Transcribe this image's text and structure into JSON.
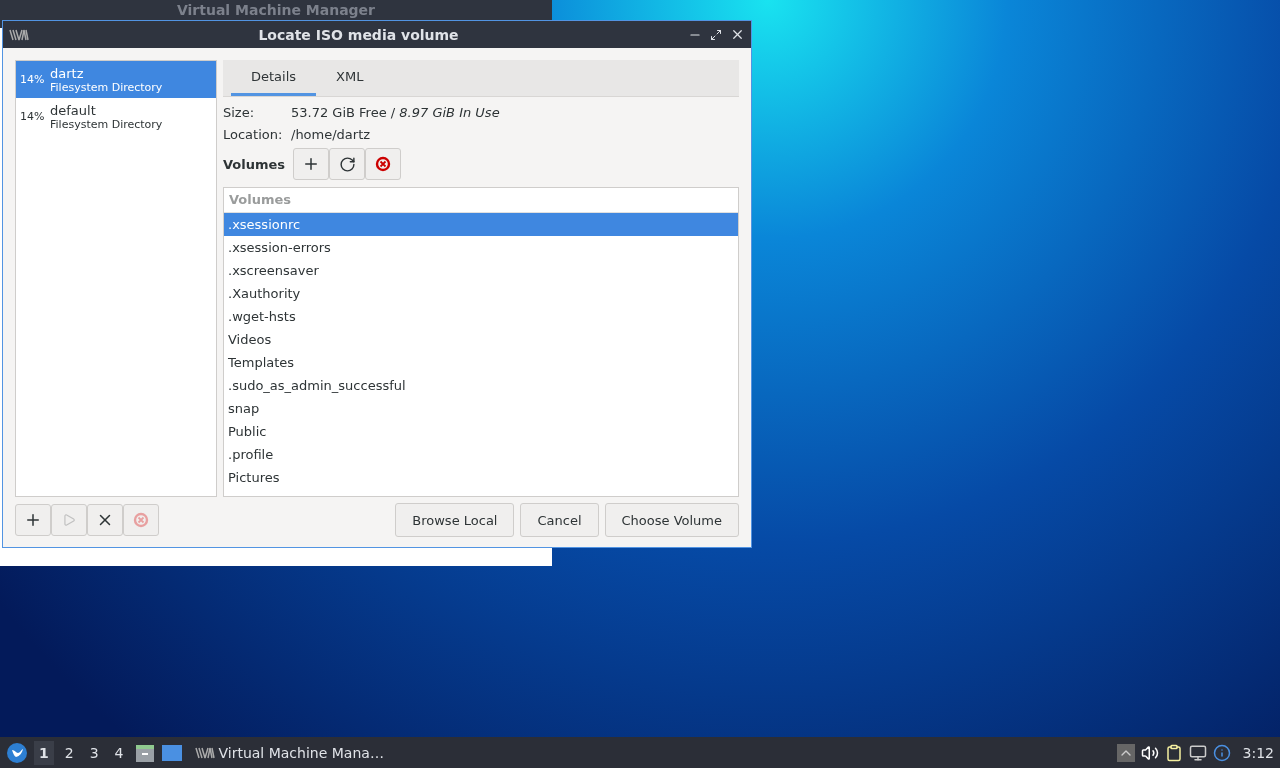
{
  "background_window": {
    "title": "Virtual Machine Manager"
  },
  "dialog": {
    "title": "Locate ISO media volume",
    "pools": [
      {
        "usage": "14%",
        "name": "dartz",
        "type": "Filesystem Directory",
        "selected": true
      },
      {
        "usage": "14%",
        "name": "default",
        "type": "Filesystem Directory",
        "selected": false
      }
    ],
    "pool_buttons": [
      {
        "kind": "plus",
        "disabled": false
      },
      {
        "kind": "play",
        "disabled": true
      },
      {
        "kind": "cross",
        "disabled": false
      },
      {
        "kind": "stop",
        "disabled": true
      }
    ],
    "tabs": [
      {
        "label": "Details",
        "selected": true
      },
      {
        "label": "XML",
        "selected": false
      }
    ],
    "size": {
      "label": "Size:",
      "value": "53.72 GiB Free / *8.97 GiB In Use*"
    },
    "location": {
      "label": "Location:",
      "value": "/home/dartz"
    },
    "volumes_label": "Volumes",
    "volume_buttons": [
      {
        "kind": "plus",
        "disabled": false
      },
      {
        "kind": "refresh",
        "disabled": false
      },
      {
        "kind": "stop",
        "disabled": false
      }
    ],
    "volume_column": "Volumes",
    "volumes": [
      {
        "name": ".xsessionrc",
        "selected": true
      },
      {
        "name": ".xsession-errors",
        "selected": false
      },
      {
        "name": ".xscreensaver",
        "selected": false
      },
      {
        "name": ".Xauthority",
        "selected": false
      },
      {
        "name": ".wget-hsts",
        "selected": false
      },
      {
        "name": "Videos",
        "selected": false
      },
      {
        "name": "Templates",
        "selected": false
      },
      {
        "name": ".sudo_as_admin_successful",
        "selected": false
      },
      {
        "name": "snap",
        "selected": false
      },
      {
        "name": "Public",
        "selected": false
      },
      {
        "name": ".profile",
        "selected": false
      },
      {
        "name": "Pictures",
        "selected": false
      }
    ],
    "buttons": [
      "Browse Local",
      "Cancel",
      "Choose Volume"
    ]
  },
  "taskbar": {
    "workspaces": [
      {
        "label": "1",
        "selected": true
      },
      {
        "label": "2",
        "selected": false
      },
      {
        "label": "3",
        "selected": false
      },
      {
        "label": "4",
        "selected": false
      }
    ],
    "task": "Virtual Machine Mana…",
    "clock": "3:12"
  }
}
